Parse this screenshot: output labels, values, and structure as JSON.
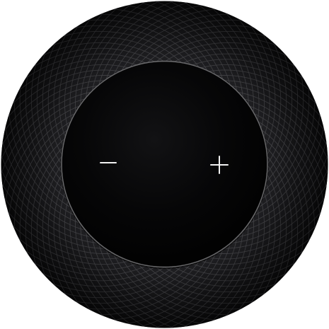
{
  "device": {
    "controls": {
      "volume_down": {
        "icon": "minus-icon"
      },
      "volume_up": {
        "icon": "plus-icon"
      }
    }
  },
  "colors": {
    "mesh_dark": "#1c1c1e",
    "mesh_line": "#4a4a4d",
    "panel_black": "#050505",
    "rim_highlight": "#6b6b6e",
    "glyph": "#f2f2f2",
    "background": "#ffffff"
  }
}
